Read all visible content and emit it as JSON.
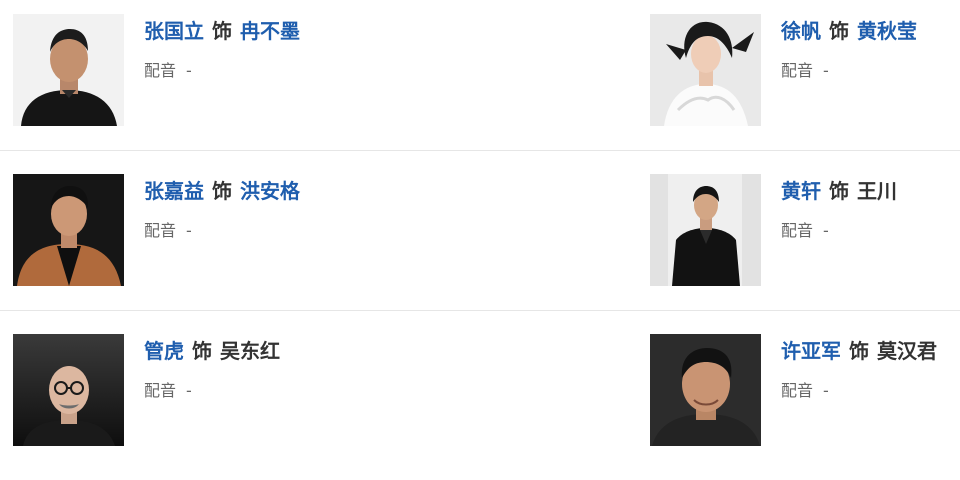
{
  "cast": [
    {
      "actor": "张国立",
      "sep": "饰",
      "role": "冉不墨",
      "role_link": true,
      "voice_label": "配音",
      "voice_value": "-"
    },
    {
      "actor": "徐帆",
      "sep": "饰",
      "role": "黄秋莹",
      "role_link": true,
      "voice_label": "配音",
      "voice_value": "-"
    },
    {
      "actor": "张嘉益",
      "sep": "饰",
      "role": "洪安格",
      "role_link": true,
      "voice_label": "配音",
      "voice_value": "-"
    },
    {
      "actor": "黄轩",
      "sep": "饰",
      "role": "王川",
      "role_link": false,
      "voice_label": "配音",
      "voice_value": "-"
    },
    {
      "actor": "管虎",
      "sep": "饰",
      "role": "吴东红",
      "role_link": false,
      "voice_label": "配音",
      "voice_value": "-"
    },
    {
      "actor": "许亚军",
      "sep": "饰",
      "role": "莫汉君",
      "role_link": false,
      "voice_label": "配音",
      "voice_value": "-"
    }
  ],
  "colors": {
    "link": "#1f5eae",
    "text": "#333333",
    "muted": "#666666",
    "divider": "#e6e6e6"
  }
}
